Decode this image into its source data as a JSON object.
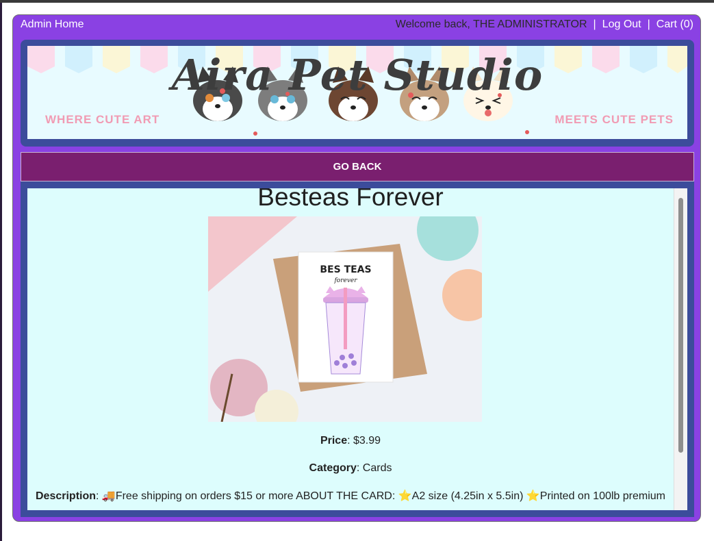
{
  "topbar": {
    "admin_home": "Admin Home",
    "welcome": "Welcome back, THE ADMINISTRATOR",
    "separator": "|",
    "logout": "Log Out",
    "cart": "Cart (0)"
  },
  "banner": {
    "title": "Aira Pet Studio",
    "left_text": "WHERE CUTE ART",
    "right_text": "MEETS CUTE PETS"
  },
  "nav": {
    "go_back": "GO BACK"
  },
  "product": {
    "title": "Besteas Forever",
    "image_card_text": "BES TEAS",
    "image_card_sub": "forever",
    "price_label": "Price",
    "price_value": ": $3.99",
    "category_label": "Category",
    "category_value": ": Cards",
    "description_label": "Description",
    "description_value": ": 🚚Free shipping on orders $15 or more ABOUT THE CARD: ⭐A2 size (4.25in x 5.5in) ⭐Printed on 100lb premium"
  },
  "colors": {
    "frame": "#8a41e3",
    "banner_border": "#3c4c9b",
    "go_back_bg": "#7a1f6f",
    "panel_bg": "#ddfdfd"
  }
}
